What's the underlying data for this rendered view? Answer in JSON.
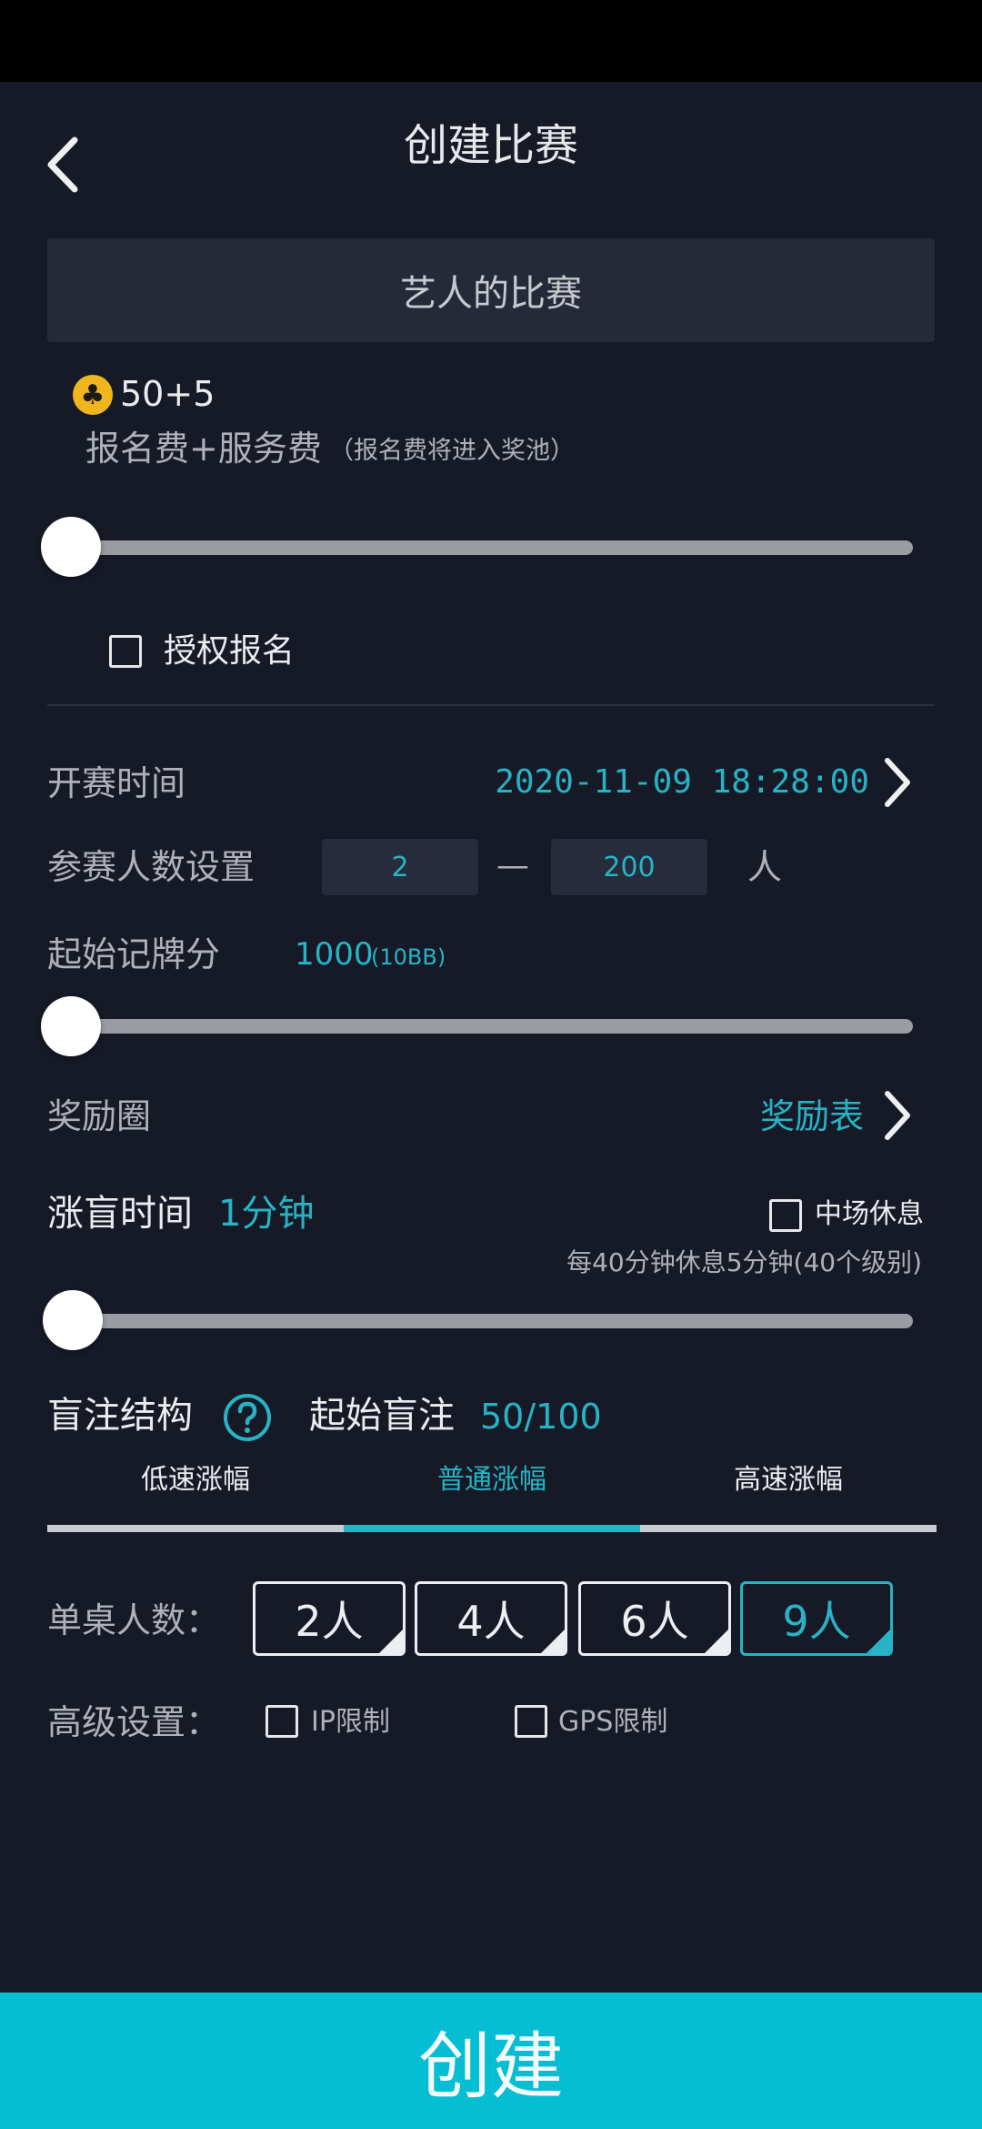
{
  "header": {
    "title": "创建比赛"
  },
  "match_name": {
    "value": "艺人的比赛"
  },
  "entry_fee": {
    "coin_icon": "club-coin-icon",
    "amount": "50+5",
    "label": "报名费+服务费",
    "note": "（报名费将进入奖池）",
    "slider_position": 0
  },
  "authorized_signup": {
    "label": "授权报名",
    "checked": false
  },
  "start_time": {
    "label": "开赛时间",
    "value": "2020-11-09 18:28:00"
  },
  "players": {
    "label": "参赛人数设置",
    "min": "2",
    "separator": "—",
    "max": "200",
    "unit": "人"
  },
  "starting_chips": {
    "label": "起始记牌分",
    "value": "1000",
    "bb": "(10BB)",
    "slider_position": 0
  },
  "bubble": {
    "label": "奖励圈",
    "link": "奖励表"
  },
  "blind_time": {
    "label": "涨盲时间",
    "value": "1分钟",
    "break_label": "中场休息",
    "break_checked": false,
    "break_note": "每40分钟休息5分钟(40个级别)",
    "slider_position": 0
  },
  "blind_structure": {
    "label": "盲注结构",
    "start_label": "起始盲注",
    "start_value": "50/100",
    "tabs": [
      "低速涨幅",
      "普通涨幅",
      "高速涨幅"
    ],
    "active_tab": 1
  },
  "seats": {
    "label": "单桌人数：",
    "options": [
      "2人",
      "4人",
      "6人",
      "9人"
    ],
    "selected": 3
  },
  "advanced": {
    "label": "高级设置：",
    "ip_label": "IP限制",
    "ip_checked": false,
    "gps_label": "GPS限制",
    "gps_checked": false
  },
  "create_button": {
    "label": "创建"
  },
  "colors": {
    "background": "#161a27",
    "accent": "#27b3c5",
    "primary_button": "#06bed3",
    "coin": "#f0b61d"
  }
}
